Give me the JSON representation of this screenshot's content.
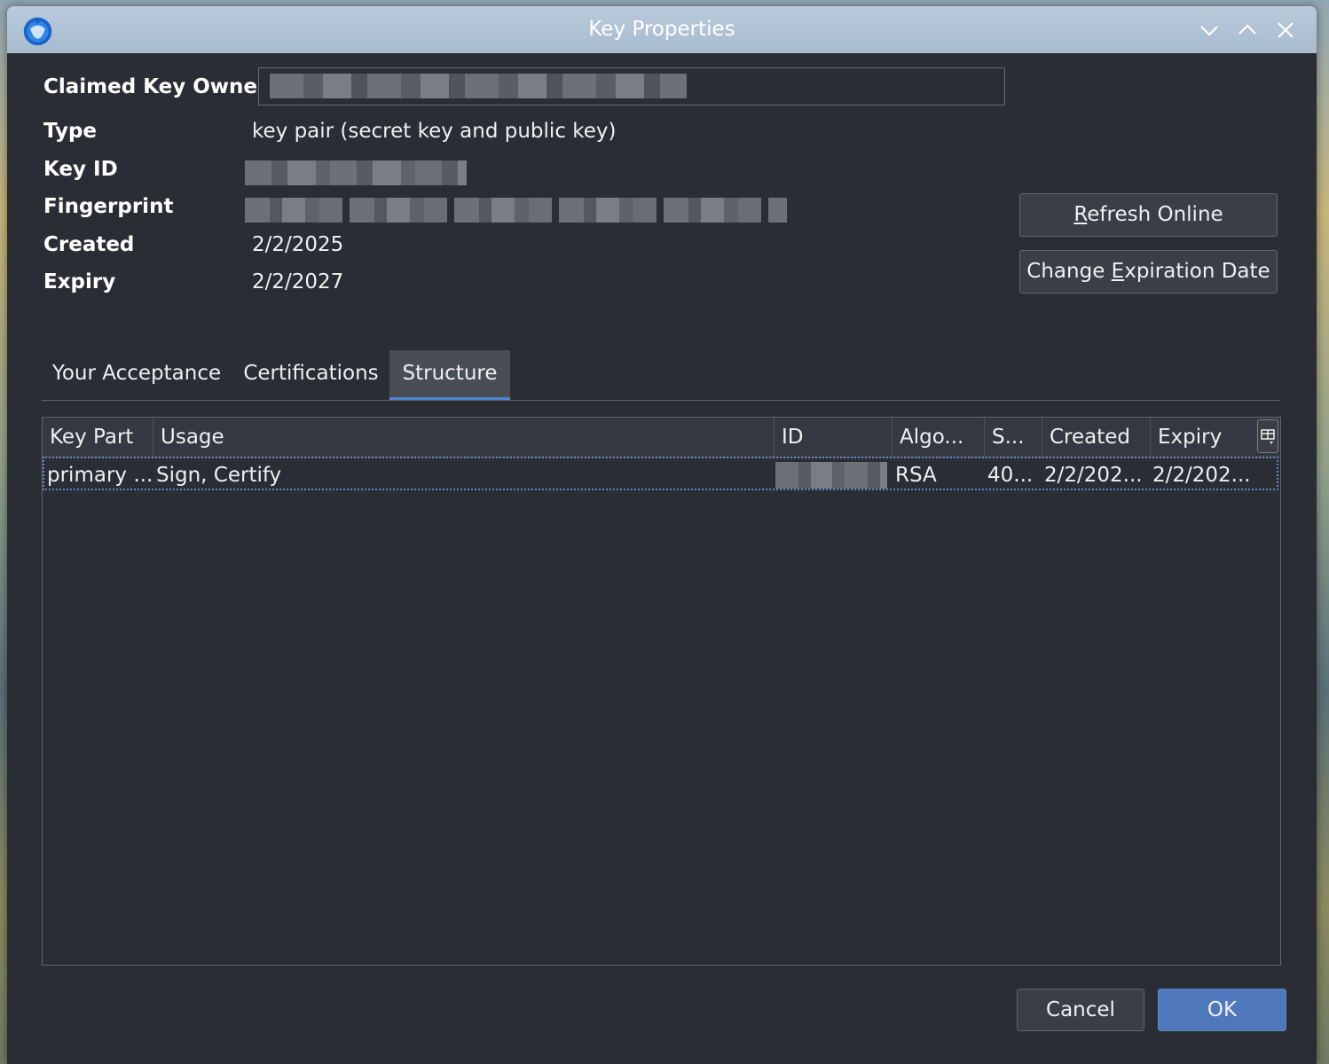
{
  "window": {
    "title": "Key Properties"
  },
  "details": {
    "owner_label": "Claimed Key Owner",
    "type_label": "Type",
    "type_value": "key pair (secret key and public key)",
    "keyid_label": "Key ID",
    "fingerprint_label": "Fingerprint",
    "created_label": "Created",
    "created_value": "2/2/2025",
    "expiry_label": "Expiry",
    "expiry_value": "2/2/2027"
  },
  "actions": {
    "refresh_prefix": "",
    "refresh_mnemonic": "R",
    "refresh_rest": "efresh Online",
    "change_prefix": "Change ",
    "change_mnemonic": "E",
    "change_rest": "xpiration Date"
  },
  "tabs": [
    "Your Acceptance",
    "Certifications",
    "Structure"
  ],
  "table": {
    "columns": [
      "Key Part",
      "Usage",
      "ID",
      "Algo...",
      "S...",
      "Created",
      "Expiry"
    ],
    "rows": [
      [
        "primary ...",
        "Sign, Certify",
        "",
        "RSA",
        "40...",
        "2/2/202...",
        "2/2/202..."
      ]
    ]
  },
  "footer": {
    "cancel": "Cancel",
    "ok": "OK"
  }
}
